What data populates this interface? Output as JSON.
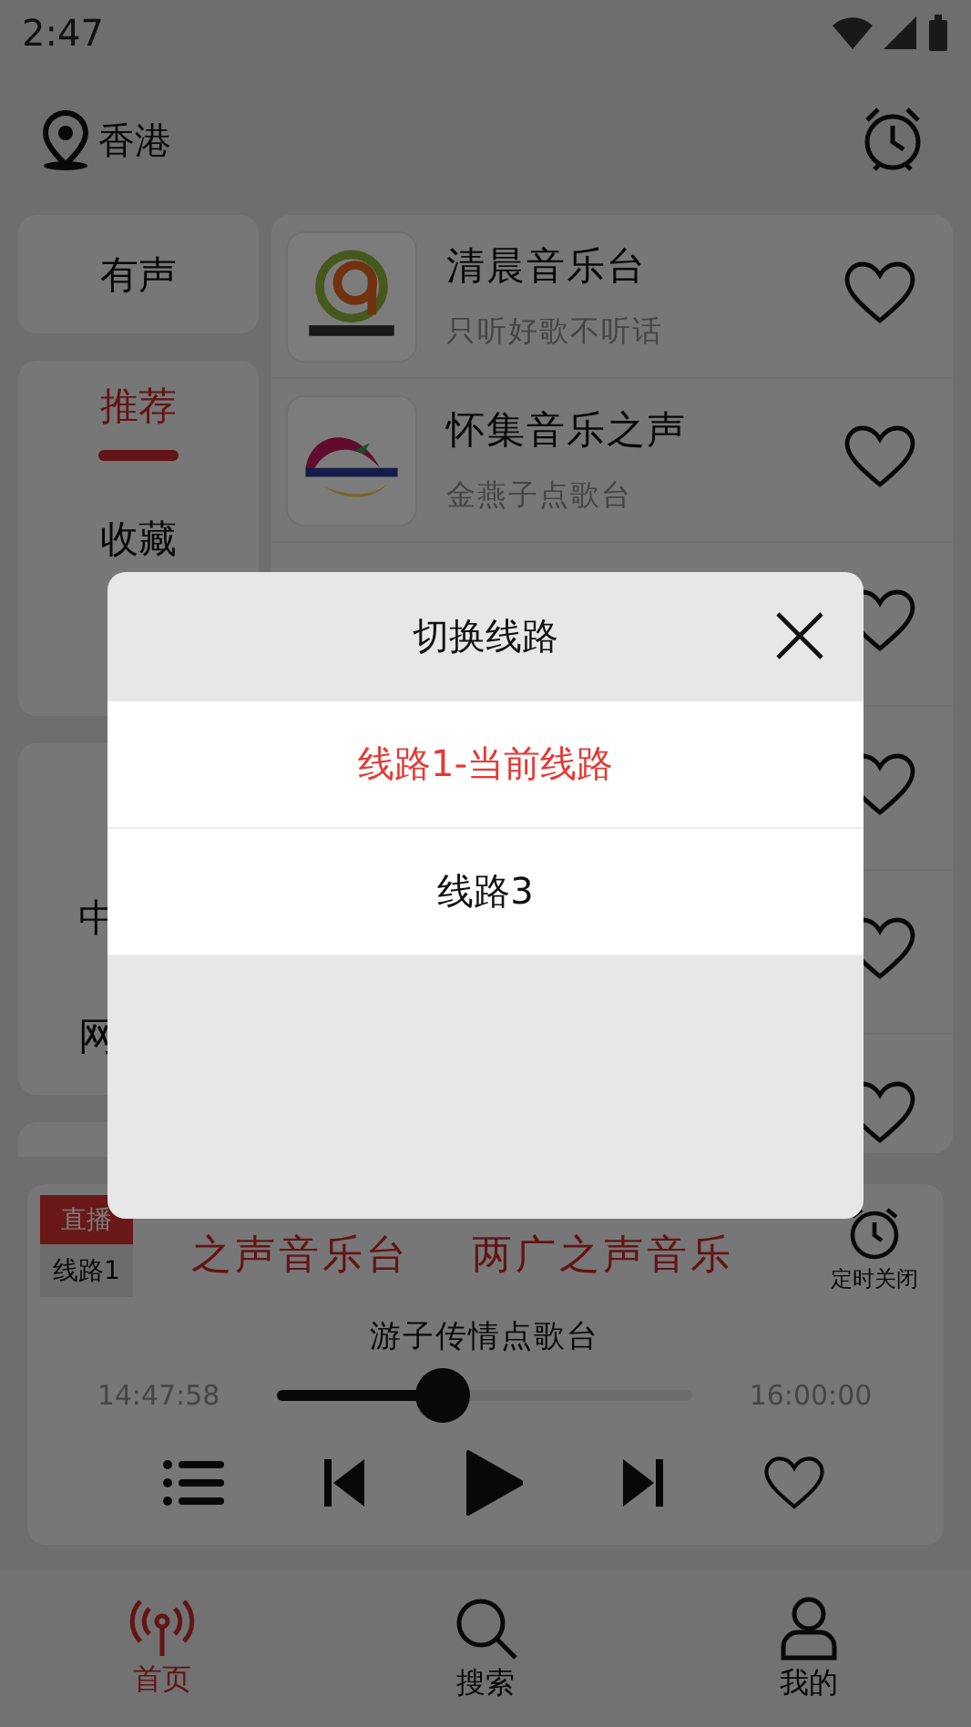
{
  "status_bar": {
    "time": "2:47"
  },
  "header": {
    "location": "香港"
  },
  "sidebar": {
    "groups": [
      {
        "items": [
          {
            "label": "有声",
            "selected": false
          }
        ]
      },
      {
        "items": [
          {
            "label": "推荐",
            "selected": true
          },
          {
            "label": "收藏",
            "selected": false
          }
        ]
      },
      {
        "items": [
          {
            "label": "中",
            "selected": false
          },
          {
            "label": "网",
            "selected": false
          }
        ]
      }
    ]
  },
  "stations": [
    {
      "kind": "full",
      "name": "清晨音乐台",
      "slogan": "只听好歌不听话",
      "favorite": false
    },
    {
      "kind": "full",
      "name": "怀集音乐之声",
      "slogan": "金燕子点歌台",
      "favorite": false
    },
    {
      "kind": "hidden",
      "favorite": false
    },
    {
      "kind": "hidden",
      "favorite": false
    },
    {
      "kind": "hidden",
      "favorite": false
    },
    {
      "kind": "hidden",
      "favorite": false
    }
  ],
  "player": {
    "live_badge": "直播",
    "line_badge": "线路1",
    "marquee": [
      "之声音乐台",
      "两广之声音乐"
    ],
    "timer_label": "定时关闭",
    "title": "游子传情点歌台",
    "elapsed": "14:47:58",
    "level": 0.4,
    "end": "16:00:00",
    "favorite": false
  },
  "bottom_nav": [
    {
      "label": "首页",
      "selected": true
    },
    {
      "label": "搜索",
      "selected": false
    },
    {
      "label": "我的",
      "selected": false
    }
  ],
  "dialog": {
    "title": "切换线路",
    "options": [
      {
        "label": "线路1-当前线路",
        "selected": true
      },
      {
        "label": "线路3",
        "selected": false
      }
    ]
  }
}
